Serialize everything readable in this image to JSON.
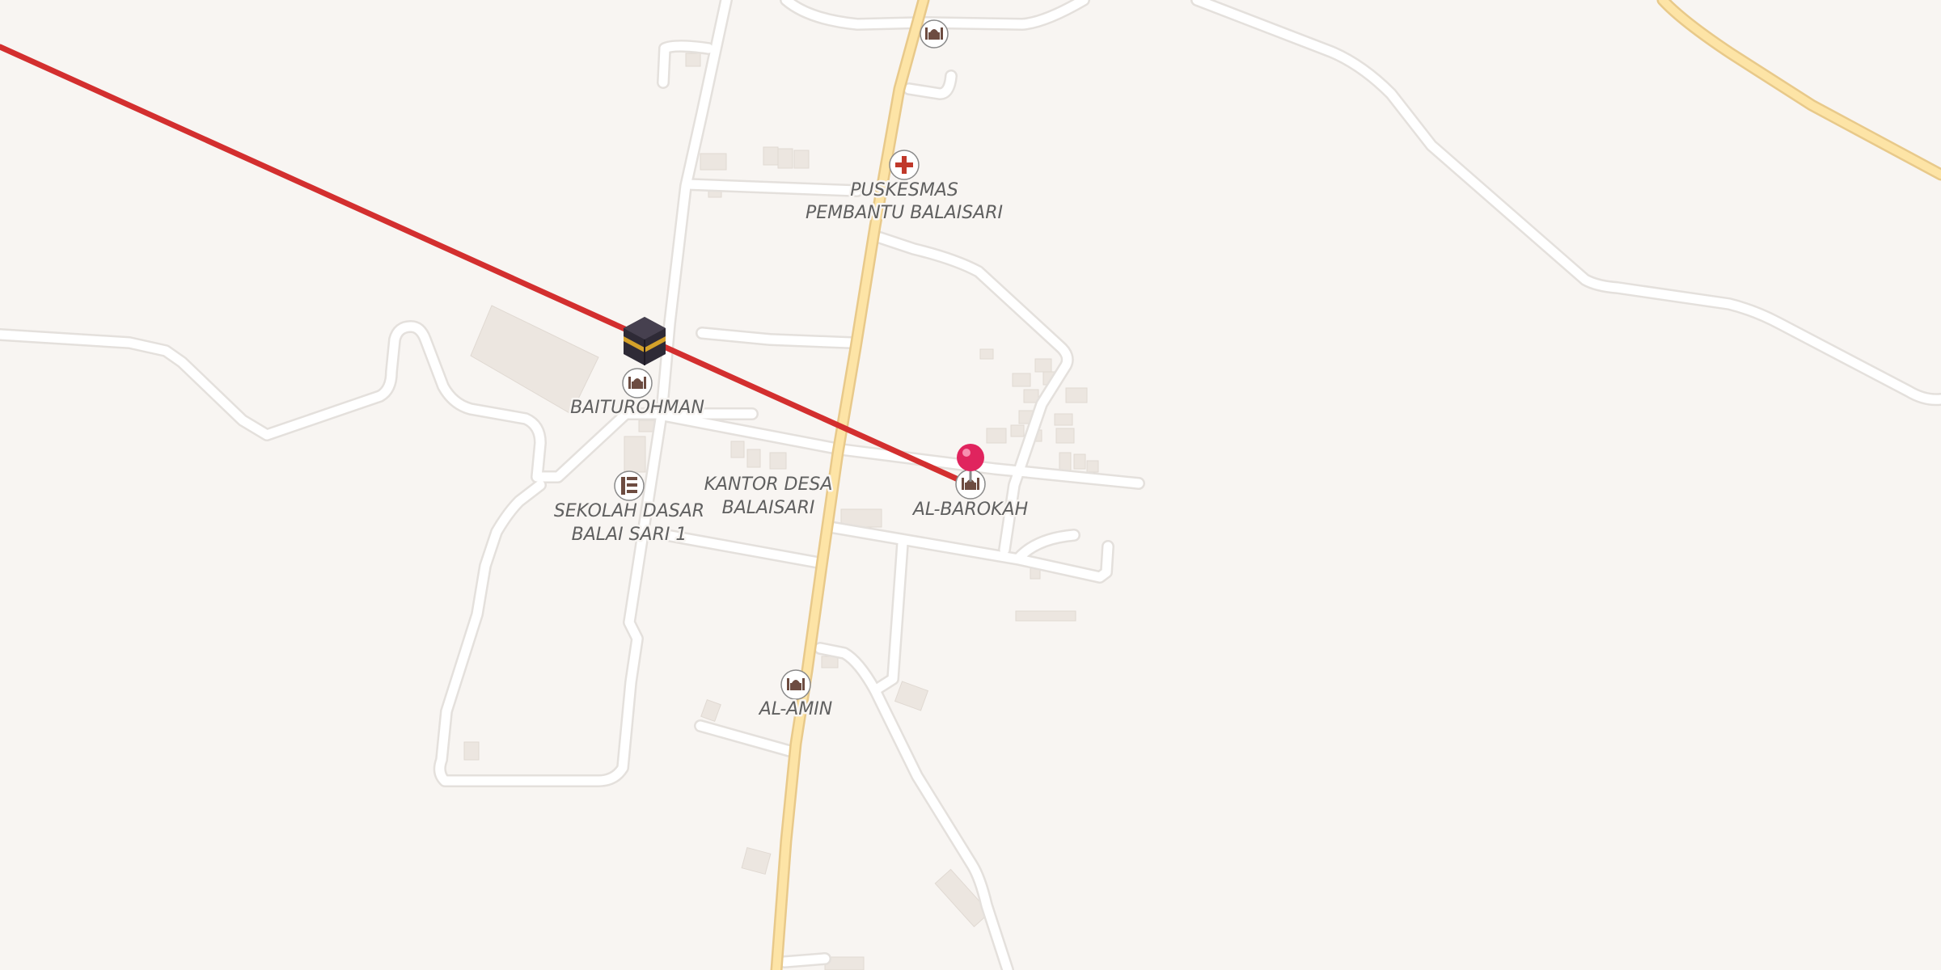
{
  "map": {
    "background_color": "#f8f5f2",
    "road_color": "#ffffff",
    "main_road_color": "#fde4a6",
    "qibla_line_color": "#d32f2f",
    "pin_color": "#e0245e"
  },
  "labels": {
    "puskesmas_line1": "PUSKESMAS",
    "puskesmas_line2": "PEMBANTU BALAISARI",
    "baiturohman": "BAITUROHMAN",
    "kantor_line1": "KANTOR DESA",
    "kantor_line2": "BALAISARI",
    "sekolah_line1": "SEKOLAH DASAR",
    "sekolah_line2": "BALAI SARI 1",
    "al_barokah": "AL-BAROKAH",
    "al_amin": "AL-AMIN"
  },
  "icons": {
    "kaaba": "kaaba-icon",
    "mosque": "mosque-icon",
    "hospital": "hospital-icon",
    "school": "school-icon",
    "pin": "location-pin-icon"
  }
}
